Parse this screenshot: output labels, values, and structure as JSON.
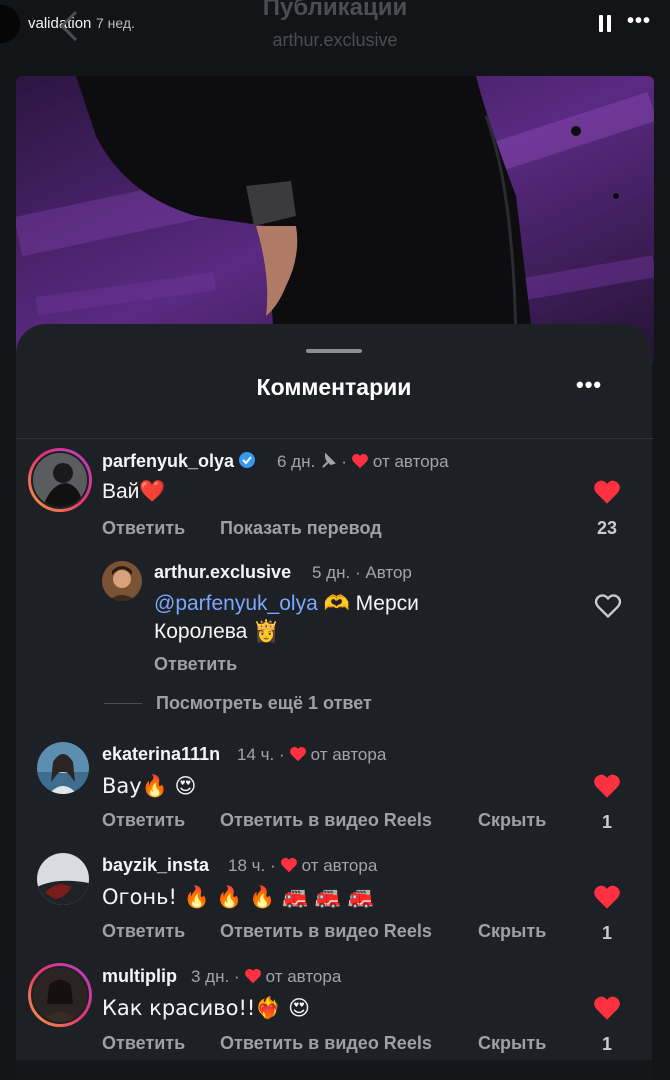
{
  "story": {
    "username": "validation",
    "time": "7 нед."
  },
  "background": {
    "title": "Публикации",
    "subtitle": "arthur.exclusive"
  },
  "sheet": {
    "title": "Комментарии"
  },
  "comments": [
    {
      "username": "parfenyuk_olya",
      "time": "6 дн.",
      "liked_by_author": "от автора",
      "text": "Вай❤️",
      "actions": [
        "Ответить",
        "Показать перевод"
      ],
      "likes": "23"
    },
    {
      "username": "arthur.exclusive",
      "time": "5 дн.",
      "badge": "Автор",
      "mention": "@parfenyuk_olya",
      "text_line1": " 🫶 Мерси",
      "text_line2": "Королева 👸",
      "actions": [
        "Ответить"
      ]
    },
    {
      "username": "ekaterina111n",
      "time": "14 ч.",
      "liked_by_author": "от автора",
      "text": "Вау🔥 😍",
      "actions": [
        "Ответить",
        "Ответить в видео Reels",
        "Скрыть"
      ],
      "likes": "1"
    },
    {
      "username": "bayzik_insta",
      "time": "18 ч.",
      "liked_by_author": "от автора",
      "text": "Огонь! 🔥 🔥 🔥 🚒 🚒 🚒",
      "actions": [
        "Ответить",
        "Ответить в видео Reels",
        "Скрыть"
      ],
      "likes": "1"
    },
    {
      "username": "multiplip",
      "time": "3 дн.",
      "liked_by_author": "от автора",
      "text": "Как красиво!!❤️‍🔥 😍",
      "actions": [
        "Ответить",
        "Ответить в видео Reels",
        "Скрыть"
      ],
      "likes": "1"
    }
  ],
  "view_replies": "Посмотреть ещё 1 ответ",
  "separator": "·",
  "colors": {
    "heart": "#ff3040",
    "mention": "#7aa7ff",
    "verified": "#3897f0",
    "sheet_bg": "#1d2024"
  },
  "icons": [
    "pause-icon",
    "more-icon",
    "back-icon",
    "heart-icon",
    "verified-icon",
    "pin-icon"
  ]
}
